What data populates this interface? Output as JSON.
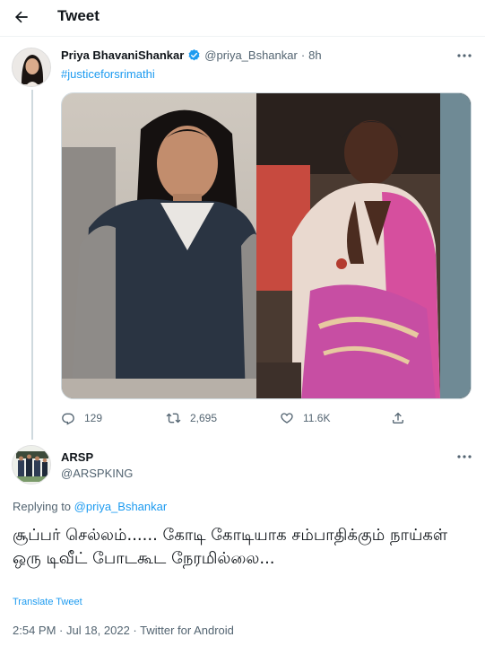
{
  "header": {
    "back_icon": "arrow-left-icon",
    "title": "Tweet"
  },
  "tweet": {
    "author": {
      "display_name": "Priya BhavaniShankar",
      "handle": "@priya_Bshankar",
      "verified": true,
      "verified_color": "#1d9bf0"
    },
    "separator": "·",
    "time": "8h",
    "hashtag": "#justiceforsrimathi",
    "actions": {
      "replies": "129",
      "retweets": "2,695",
      "likes": "11.6K"
    }
  },
  "reply": {
    "author": {
      "display_name": "ARSP",
      "handle": "@ARSPKING"
    },
    "replying_prefix": "Replying to",
    "replying_to": "@priya_Bshankar",
    "text": "சூப்பர் செல்லம்...... கோடி கோடியாக சம்பாதிக்கும் நாய்கள் ஒரு டிவீட் போடகூட நேரமில்லை...",
    "translate_label": "Translate Tweet",
    "meta": "2:54 PM · Jul 18, 2022 · Twitter for Android"
  },
  "colors": {
    "accent": "#1d9bf0",
    "secondary_text": "#536471",
    "primary_text": "#0f1419",
    "border": "#cfd9de"
  }
}
